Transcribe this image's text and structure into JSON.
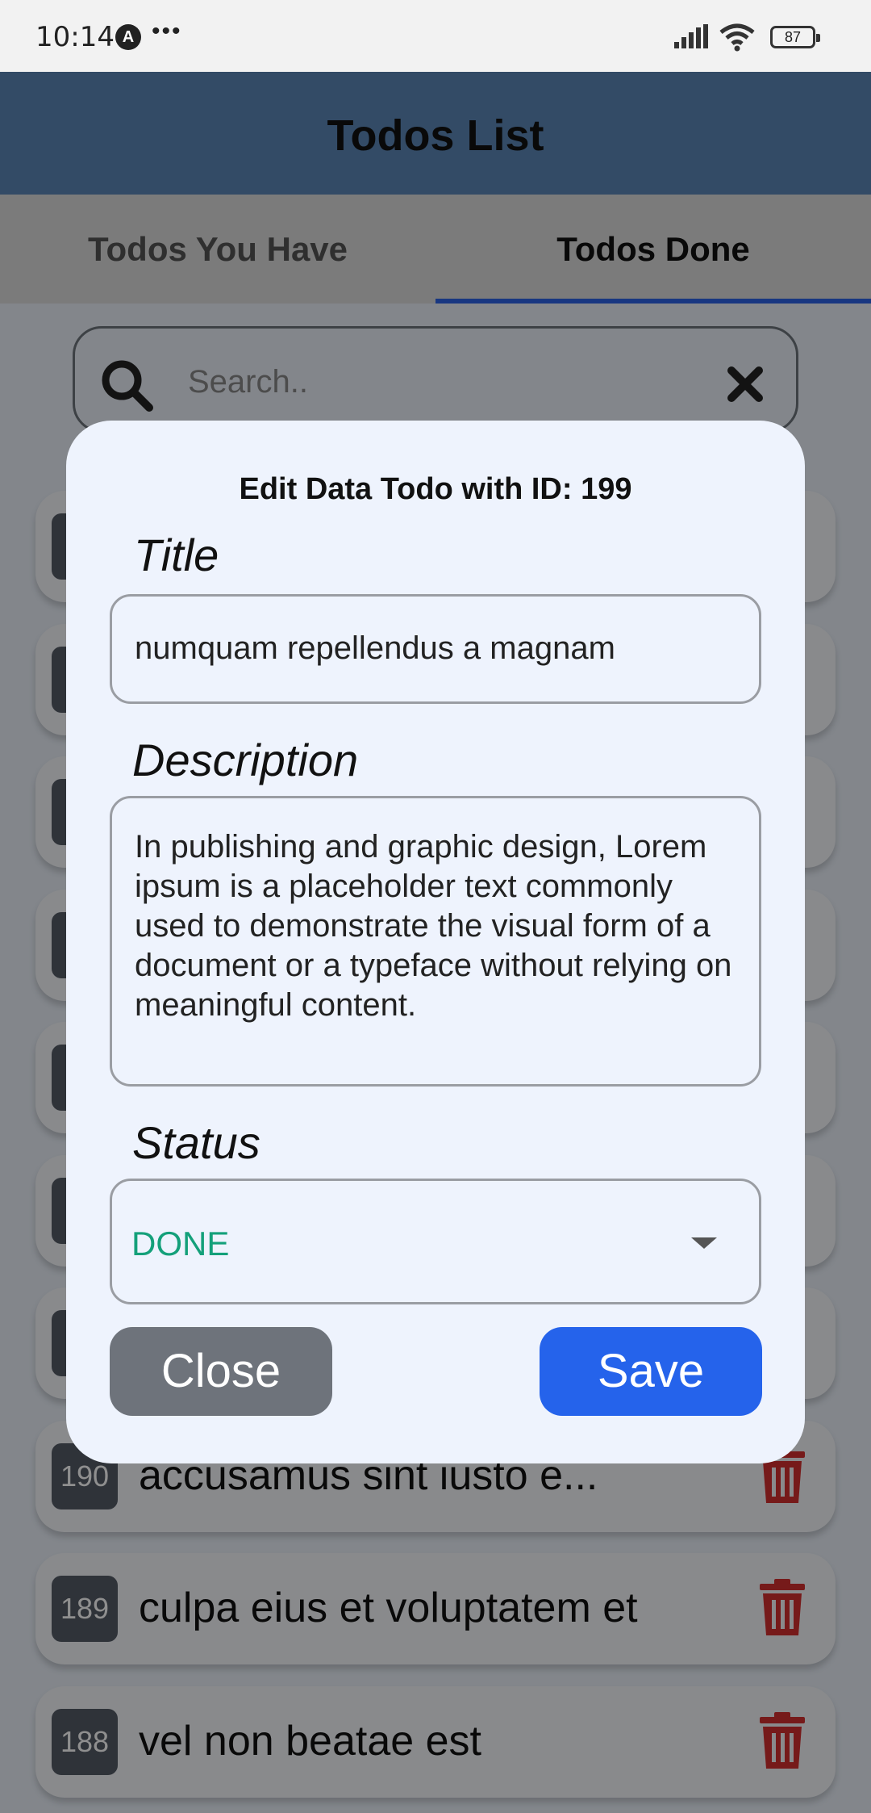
{
  "status_bar": {
    "time": "10:14",
    "app_badge": "A",
    "more": "•••",
    "battery": "87"
  },
  "app": {
    "title": "Todos List"
  },
  "tabs": [
    {
      "label": "Todos You Have"
    },
    {
      "label": "Todos Done"
    }
  ],
  "search": {
    "placeholder": "Search.."
  },
  "todos": [
    {
      "id": "190",
      "title": "accusamus sint iusto e..."
    },
    {
      "id": "189",
      "title": "culpa eius et voluptatem et"
    },
    {
      "id": "188",
      "title": "vel non beatae est"
    }
  ],
  "dialog": {
    "heading": "Edit Data Todo with ID: 199",
    "title_label": "Title",
    "title_value": "numquam repellendus a magnam",
    "description_label": "Description",
    "description_value": "In publishing and graphic design, Lorem ipsum is a placeholder text commonly used to demonstrate the visual form of a document or a typeface without relying on meaningful content.",
    "status_label": "Status",
    "status_value": "DONE",
    "close_label": "Close",
    "save_label": "Save"
  },
  "colors": {
    "header": "#5b86b7",
    "tab_indicator": "#2b62e6",
    "save_button": "#2563eb",
    "close_button": "#6e737b",
    "status_done": "#14a07a",
    "delete_icon": "#d32f2f"
  }
}
